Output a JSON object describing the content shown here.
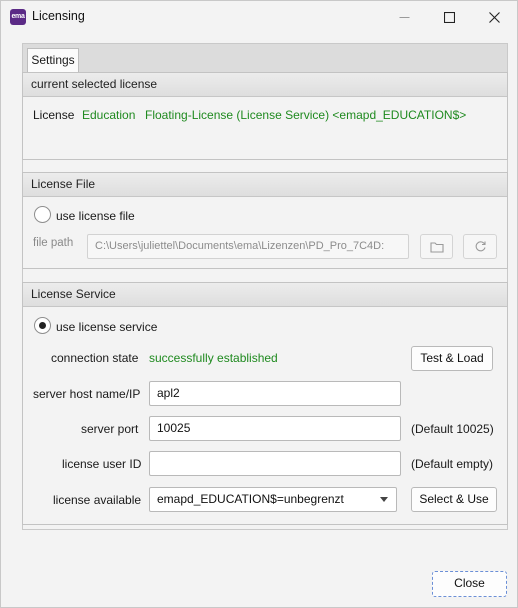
{
  "window": {
    "title": "Licensing",
    "logo_text": "ema",
    "icons": {
      "minimize": "minimize-icon",
      "maximize": "maximize-icon",
      "close": "close-icon"
    }
  },
  "tabs": [
    {
      "label": "Settings",
      "active": true
    }
  ],
  "current_license": {
    "heading": "current selected license",
    "label": "License",
    "edition": "Education",
    "details": "Floating-License (License Service) <emapd_EDUCATION$>"
  },
  "license_file": {
    "heading": "License File",
    "radio_label": "use license file",
    "radio_selected": false,
    "path_label": "file path",
    "path_value": "C:\\Users\\juliettel\\Documents\\ema\\Lizenzen\\PD_Pro_7C4D:",
    "icons": {
      "browse": "folder-icon",
      "reload": "refresh-icon"
    }
  },
  "license_service": {
    "heading": "License Service",
    "radio_label": "use license service",
    "radio_selected": true,
    "connection_label": "connection state",
    "connection_value": "successfully established",
    "test_button": "Test & Load",
    "host_label": "server host name/IP",
    "host_value": "apl2",
    "port_label": "server port",
    "port_value": "10025",
    "port_hint": "(Default 10025)",
    "user_label": "license user ID",
    "user_value": "",
    "user_hint": "(Default empty)",
    "available_label": "license available",
    "available_value": "emapd_EDUCATION$=unbegrenzt",
    "select_button": "Select & Use"
  },
  "footer": {
    "close_button": "Close"
  },
  "colors": {
    "success_text": "#1f8a1f",
    "logo_bg": "#5b2a86",
    "focus_border": "#6b8fd6"
  }
}
